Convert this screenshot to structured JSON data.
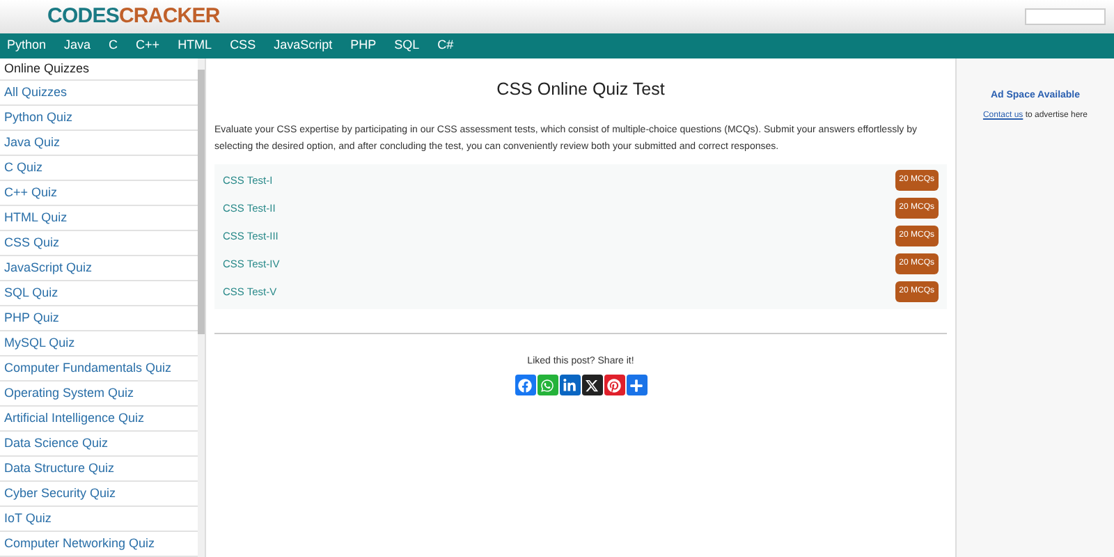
{
  "logo": {
    "part_1": "CODES",
    "part_2": "CRACKER"
  },
  "nav": [
    "Python",
    "Java",
    "C",
    "C++",
    "HTML",
    "CSS",
    "JavaScript",
    "PHP",
    "SQL",
    "C#"
  ],
  "sidebar": {
    "heading": "Online Quizzes",
    "items": [
      "All Quizzes",
      "Python Quiz",
      "Java Quiz",
      "C Quiz",
      "C++ Quiz",
      "HTML Quiz",
      "CSS Quiz",
      "JavaScript Quiz",
      "SQL Quiz",
      "PHP Quiz",
      "MySQL Quiz",
      "Computer Fundamentals Quiz",
      "Operating System Quiz",
      "Artificial Intelligence Quiz",
      "Data Science Quiz",
      "Data Structure Quiz",
      "Cyber Security Quiz",
      "IoT Quiz",
      "Computer Networking Quiz"
    ]
  },
  "main": {
    "title": "CSS Online Quiz Test",
    "intro": "Evaluate your CSS expertise by participating in our CSS assessment tests, which consist of multiple-choice questions (MCQs). Submit your answers effortlessly by selecting the desired option, and after concluding the test, you can conveniently review both your submitted and correct responses.",
    "tests": [
      {
        "name": "CSS Test-I",
        "badge": "20 MCQs"
      },
      {
        "name": "CSS Test-II",
        "badge": "20 MCQs"
      },
      {
        "name": "CSS Test-III",
        "badge": "20 MCQs"
      },
      {
        "name": "CSS Test-IV",
        "badge": "20 MCQs"
      },
      {
        "name": "CSS Test-V",
        "badge": "20 MCQs"
      }
    ],
    "share_text": "Liked this post? Share it!",
    "share_buttons": [
      {
        "kind": "facebook"
      },
      {
        "kind": "whatsapp"
      },
      {
        "kind": "linkedin"
      },
      {
        "kind": "x"
      },
      {
        "kind": "pinterest"
      },
      {
        "kind": "more"
      }
    ]
  },
  "ad": {
    "title": "Ad Space Available",
    "link": "Contact us",
    "text": "to advertise here"
  }
}
